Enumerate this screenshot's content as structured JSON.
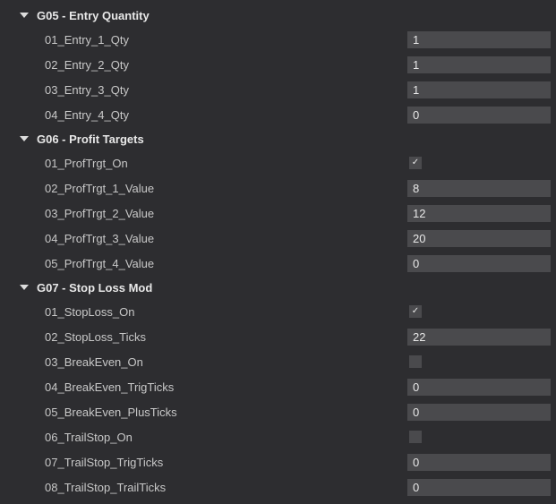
{
  "groups": [
    {
      "name": "g05",
      "title": "G05 - Entry Quantity",
      "rows": [
        {
          "name": "entry-1-qty",
          "label": "01_Entry_1_Qty",
          "type": "number",
          "value": "1"
        },
        {
          "name": "entry-2-qty",
          "label": "02_Entry_2_Qty",
          "type": "number",
          "value": "1"
        },
        {
          "name": "entry-3-qty",
          "label": "03_Entry_3_Qty",
          "type": "number",
          "value": "1"
        },
        {
          "name": "entry-4-qty",
          "label": "04_Entry_4_Qty",
          "type": "number",
          "value": "0"
        }
      ]
    },
    {
      "name": "g06",
      "title": "G06 - Profit Targets",
      "rows": [
        {
          "name": "proftrgt-on",
          "label": "01_ProfTrgt_On",
          "type": "checkbox",
          "checked": true
        },
        {
          "name": "proftrgt-1-value",
          "label": "02_ProfTrgt_1_Value",
          "type": "number",
          "value": "8"
        },
        {
          "name": "proftrgt-2-value",
          "label": "03_ProfTrgt_2_Value",
          "type": "number",
          "value": "12"
        },
        {
          "name": "proftrgt-3-value",
          "label": "04_ProfTrgt_3_Value",
          "type": "number",
          "value": "20"
        },
        {
          "name": "proftrgt-4-value",
          "label": "05_ProfTrgt_4_Value",
          "type": "number",
          "value": "0"
        }
      ]
    },
    {
      "name": "g07",
      "title": "G07 - Stop Loss Mod",
      "rows": [
        {
          "name": "stoploss-on",
          "label": "01_StopLoss_On",
          "type": "checkbox",
          "checked": true
        },
        {
          "name": "stoploss-ticks",
          "label": "02_StopLoss_Ticks",
          "type": "number",
          "value": "22"
        },
        {
          "name": "breakeven-on",
          "label": "03_BreakEven_On",
          "type": "checkbox",
          "checked": false
        },
        {
          "name": "breakeven-trigticks",
          "label": "04_BreakEven_TrigTicks",
          "type": "number",
          "value": "0"
        },
        {
          "name": "breakeven-plusticks",
          "label": "05_BreakEven_PlusTicks",
          "type": "number",
          "value": "0"
        },
        {
          "name": "trailstop-on",
          "label": "06_TrailStop_On",
          "type": "checkbox",
          "checked": false
        },
        {
          "name": "trailstop-trigticks",
          "label": "07_TrailStop_TrigTicks",
          "type": "number",
          "value": "0"
        },
        {
          "name": "trailstop-trailticks",
          "label": "08_TrailStop_TrailTicks",
          "type": "number",
          "value": "0"
        }
      ]
    }
  ]
}
